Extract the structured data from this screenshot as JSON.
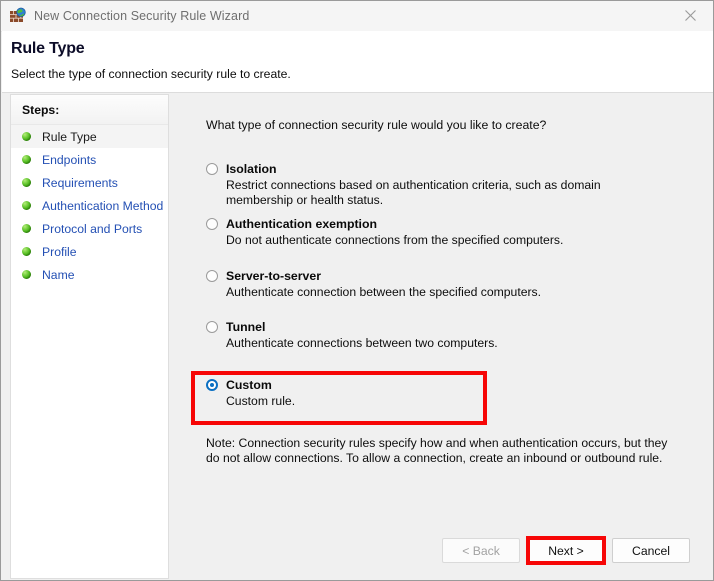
{
  "window": {
    "title": "New Connection Security Rule Wizard",
    "app_icon": "firewall-globe-icon",
    "close_icon": "close-icon"
  },
  "header": {
    "title": "Rule Type",
    "subtitle": "Select the type of connection security rule to create."
  },
  "sidebar": {
    "heading": "Steps:",
    "items": [
      {
        "label": "Rule Type",
        "active": true
      },
      {
        "label": "Endpoints",
        "active": false
      },
      {
        "label": "Requirements",
        "active": false
      },
      {
        "label": "Authentication Method",
        "active": false
      },
      {
        "label": "Protocol and Ports",
        "active": false
      },
      {
        "label": "Profile",
        "active": false
      },
      {
        "label": "Name",
        "active": false
      }
    ]
  },
  "main": {
    "question": "What type of connection security rule would you like to create?",
    "options": [
      {
        "title": "Isolation",
        "description": "Restrict connections based on authentication criteria, such as domain membership or health status.",
        "selected": false
      },
      {
        "title": "Authentication exemption",
        "description": "Do not authenticate connections from the specified computers.",
        "selected": false
      },
      {
        "title": "Server-to-server",
        "description": "Authenticate connection between the specified computers.",
        "selected": false
      },
      {
        "title": "Tunnel",
        "description": "Authenticate connections between two computers.",
        "selected": false
      },
      {
        "title": "Custom",
        "description": "Custom rule.",
        "selected": true
      }
    ],
    "note": "Note:  Connection security rules specify how and when authentication occurs, but they do not allow connections.  To allow a connection, create an inbound or outbound rule."
  },
  "footer": {
    "back_label": "< Back",
    "next_label": "Next >",
    "cancel_label": "Cancel"
  },
  "annotations": {
    "highlight_color": "#f60606",
    "targets": [
      "custom-radio-option",
      "next-button"
    ]
  }
}
